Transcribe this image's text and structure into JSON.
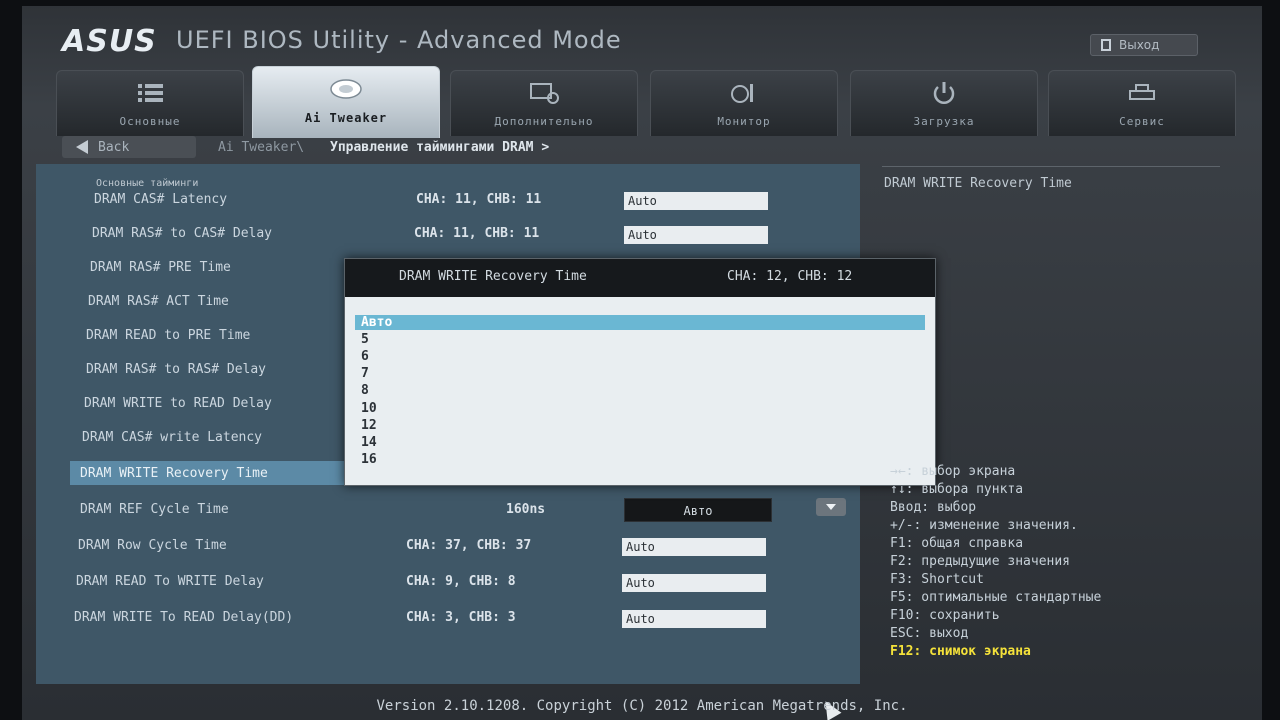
{
  "header": {
    "logo_text": "ASUS",
    "app_title": "UEFI BIOS Utility - Advanced Mode",
    "exit_label": "Выход"
  },
  "tabs": [
    {
      "label": "Основные",
      "icon": "list-icon"
    },
    {
      "label": "Ai Tweaker",
      "icon": "ai-tweaker-icon"
    },
    {
      "label": "Дополнительно",
      "icon": "advanced-icon"
    },
    {
      "label": "Монитор",
      "icon": "monitor-icon"
    },
    {
      "label": "Загрузка",
      "icon": "power-icon"
    },
    {
      "label": "Сервис",
      "icon": "tool-icon"
    }
  ],
  "active_tab": "Ai Tweaker",
  "breadcrumb": {
    "back_label": "Back",
    "path_root": "Ai Tweaker\\",
    "path_current": "Управление таймингами DRAM >"
  },
  "section_header": "Основные тайминги",
  "rows": [
    {
      "label": "DRAM CAS# Latency",
      "value": "CHA: 11, CHB: 11",
      "field": "Auto"
    },
    {
      "label": "DRAM RAS# to CAS# Delay",
      "value": "CHA: 11, CHB: 11",
      "field": "Auto"
    },
    {
      "label": "DRAM RAS# PRE Time",
      "value": "",
      "field": ""
    },
    {
      "label": "DRAM RAS# ACT Time",
      "value": "",
      "field": ""
    },
    {
      "label": "DRAM READ to PRE Time",
      "value": "",
      "field": ""
    },
    {
      "label": "DRAM RAS# to RAS# Delay",
      "value": "",
      "field": ""
    },
    {
      "label": "DRAM WRITE to READ Delay",
      "value": "",
      "field": ""
    },
    {
      "label": "DRAM CAS# write Latency",
      "value": "",
      "field": ""
    },
    {
      "label": "DRAM WRITE Recovery Time",
      "value": "",
      "field": ""
    },
    {
      "label": "DRAM REF Cycle Time",
      "value": "160ns",
      "button": "Авто"
    },
    {
      "label": "DRAM Row Cycle Time",
      "value": "CHA: 37, CHB: 37",
      "field": "Auto"
    },
    {
      "label": "DRAM READ To WRITE Delay",
      "value": "CHA:  9, CHB:  8",
      "field": "Auto"
    },
    {
      "label": "DRAM WRITE To READ Delay(DD)",
      "value": "CHA:  3, CHB:  3",
      "field": "Auto"
    }
  ],
  "selected_row": "DRAM WRITE Recovery Time",
  "popup": {
    "title": "DRAM WRITE Recovery Time",
    "value": "CHA: 12, CHB: 12",
    "options": [
      "Авто",
      "5",
      "6",
      "7",
      "8",
      "10",
      "12",
      "14",
      "16"
    ],
    "selected_option": "Авто"
  },
  "help": {
    "title": "DRAM WRITE Recovery Time",
    "keys": [
      {
        "text": "→←: выбор экрана",
        "highlight": false
      },
      {
        "text": "↑↓: выбора пункта",
        "highlight": false
      },
      {
        "text": "Ввод: выбор",
        "highlight": false
      },
      {
        "text": "+/-: изменение значения.",
        "highlight": false
      },
      {
        "text": "F1: общая справка",
        "highlight": false
      },
      {
        "text": "F2: предыдущие значения",
        "highlight": false
      },
      {
        "text": "F3: Shortcut",
        "highlight": false
      },
      {
        "text": "F5: оптимальные стандартные",
        "highlight": false
      },
      {
        "text": "F10: сохранить",
        "highlight": false
      },
      {
        "text": "ESC: выход",
        "highlight": false
      },
      {
        "text": "F12: снимок экрана",
        "highlight": true
      }
    ]
  },
  "footer": "Version 2.10.1208. Copyright (C) 2012 American Megatrends, Inc.",
  "colors": {
    "panel_bg": "#3f5767",
    "selection": "#6ab7d3",
    "help_highlight": "#f5e23a"
  }
}
